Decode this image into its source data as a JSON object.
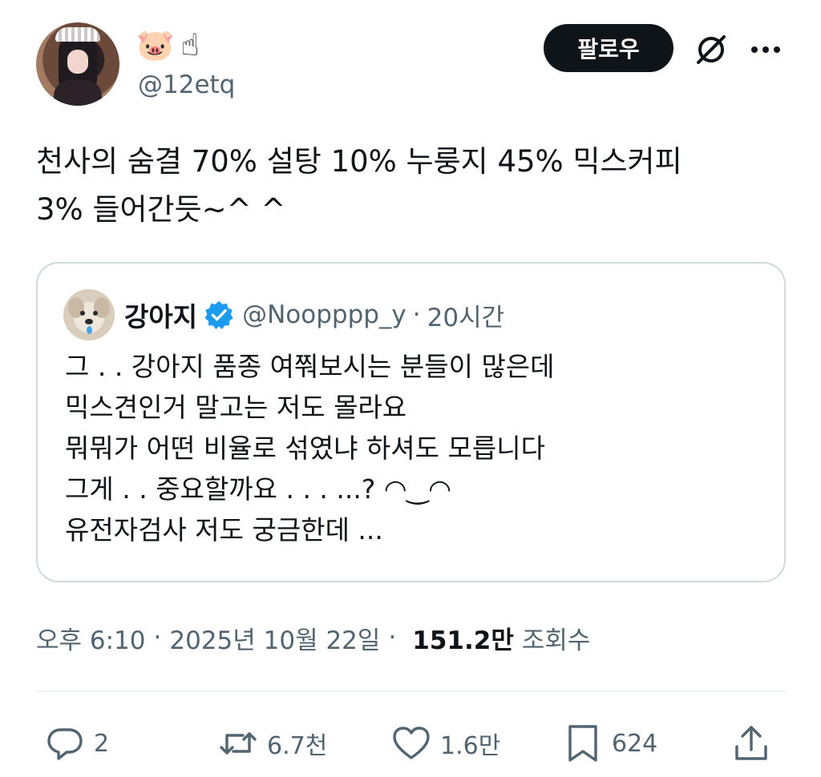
{
  "author": {
    "display_emojis": [
      "🐷",
      "☝"
    ],
    "handle": "@12etq",
    "avatar_icon": "avatar-photo"
  },
  "header": {
    "follow_label": "팔로우",
    "grok_icon": "no-entry-icon",
    "more_icon": "more-icon"
  },
  "tweet": {
    "text": "천사의 숨결 70% 설탕 10% 누룽지 45% 믹스커피\n3% 들어간듯~^ ^"
  },
  "quote": {
    "name": "강아지",
    "handle": "@Noopppp_y",
    "separator": "·",
    "time": "20시간",
    "verified_color": "#1d9bf0",
    "text": "그 . . 강아지 품종 여쭤보시는 분들이 많은데\n믹스견인거 말고는 저도 몰라요\n뭐뭐가 어떤 비율로 섞였냐 하셔도 모릅니다\n그게 . . 중요할까요 . . . ...? ◠‿◠\n유전자검사 저도 궁금한데 ..."
  },
  "meta": {
    "time": "오후 6:10",
    "sep1": "·",
    "date": "2025년 10월 22일",
    "sep2": "·",
    "views": "151.2만",
    "views_label": "조회수"
  },
  "actions": {
    "reply_count": "2",
    "retweet_count": "6.7천",
    "like_count": "1.6만",
    "bookmark_count": "624",
    "icons": [
      "reply-icon",
      "retweet-icon",
      "like-icon",
      "bookmark-icon",
      "share-icon"
    ]
  }
}
